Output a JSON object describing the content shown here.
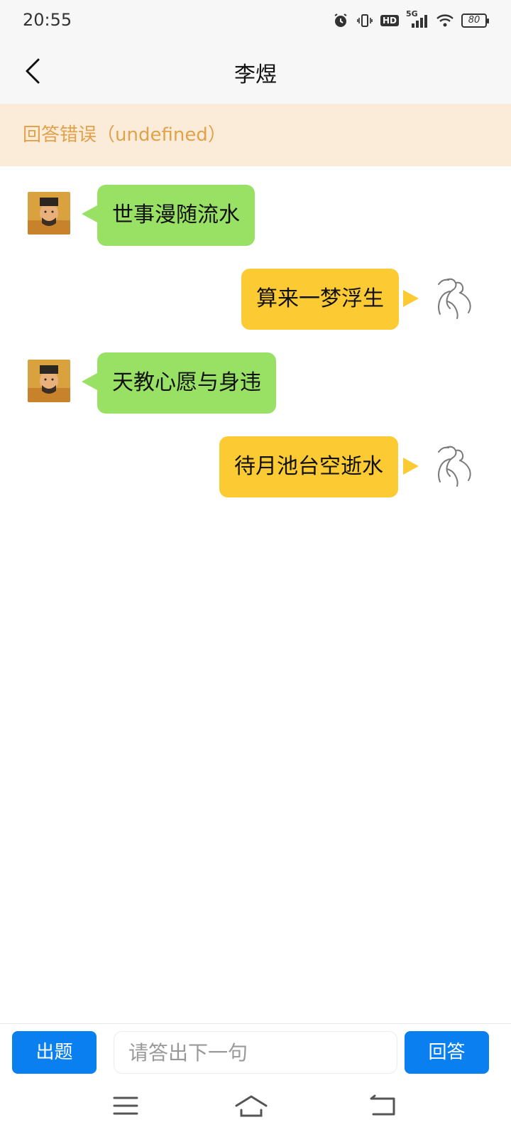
{
  "status_bar": {
    "time": "20:55",
    "network_label": "5G",
    "hd_label": "HD",
    "battery_level": "80",
    "icons": [
      "alarm-icon",
      "vibrate-icon",
      "hd-icon",
      "signal-5g-icon",
      "wifi-icon",
      "battery-icon"
    ]
  },
  "header": {
    "title": "李煜",
    "back_icon": "chevron-left-icon"
  },
  "banner": {
    "text": "回答错误（undefined）"
  },
  "messages": [
    {
      "side": "left",
      "text": "世事漫随流水"
    },
    {
      "side": "right",
      "text": "算来一梦浮生"
    },
    {
      "side": "left",
      "text": "天教心愿与身违"
    },
    {
      "side": "right",
      "text": "待月池台空逝水"
    }
  ],
  "footer": {
    "question_button": "出题",
    "answer_placeholder": "请答出下一句",
    "answer_value": "",
    "submit_button": "回答"
  },
  "system_nav": {
    "icons": [
      "menu-icon",
      "home-icon",
      "back-icon"
    ]
  },
  "colors": {
    "accent_blue": "#0a7ff0",
    "bubble_green": "#98e165",
    "bubble_yellow": "#fccb34",
    "banner_bg": "#fbebd9",
    "banner_text": "#e0a24b"
  }
}
